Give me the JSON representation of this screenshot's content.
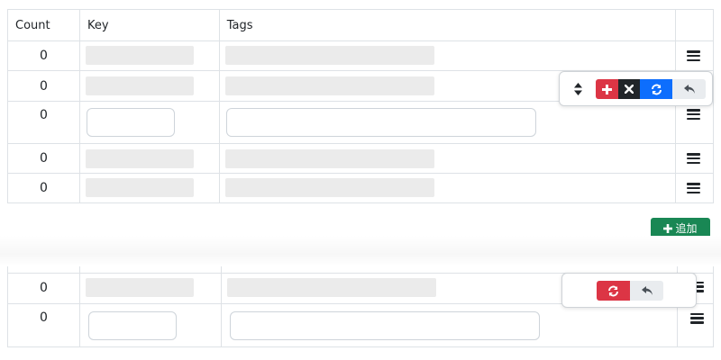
{
  "table": {
    "headers": {
      "count": "Count",
      "key": "Key",
      "tags": "Tags"
    },
    "rows": [
      {
        "count": "0",
        "state": "placeholder"
      },
      {
        "count": "0",
        "state": "placeholder"
      },
      {
        "count": "0",
        "state": "editing"
      },
      {
        "count": "0",
        "state": "placeholder"
      },
      {
        "count": "0",
        "state": "placeholder"
      }
    ]
  },
  "add_button": {
    "label": "追加",
    "icon": "plus-icon",
    "color": "#198754"
  },
  "row_actions": {
    "icons": [
      "sort-icon",
      "plus-icon",
      "times-icon",
      "sync-icon",
      "reply-icon"
    ],
    "colors": {
      "add": "#dc3545",
      "delete": "#212529",
      "refresh": "#0d6efd",
      "undo": "#e9ecef"
    }
  },
  "second_table": {
    "rows": [
      {
        "count": "0",
        "state": "placeholder"
      },
      {
        "count": "0",
        "state": "editing"
      }
    ],
    "actions": {
      "icons": [
        "sync-icon",
        "reply-icon"
      ],
      "colors": {
        "refresh": "#dc3545",
        "undo": "#e9ecef"
      }
    }
  }
}
